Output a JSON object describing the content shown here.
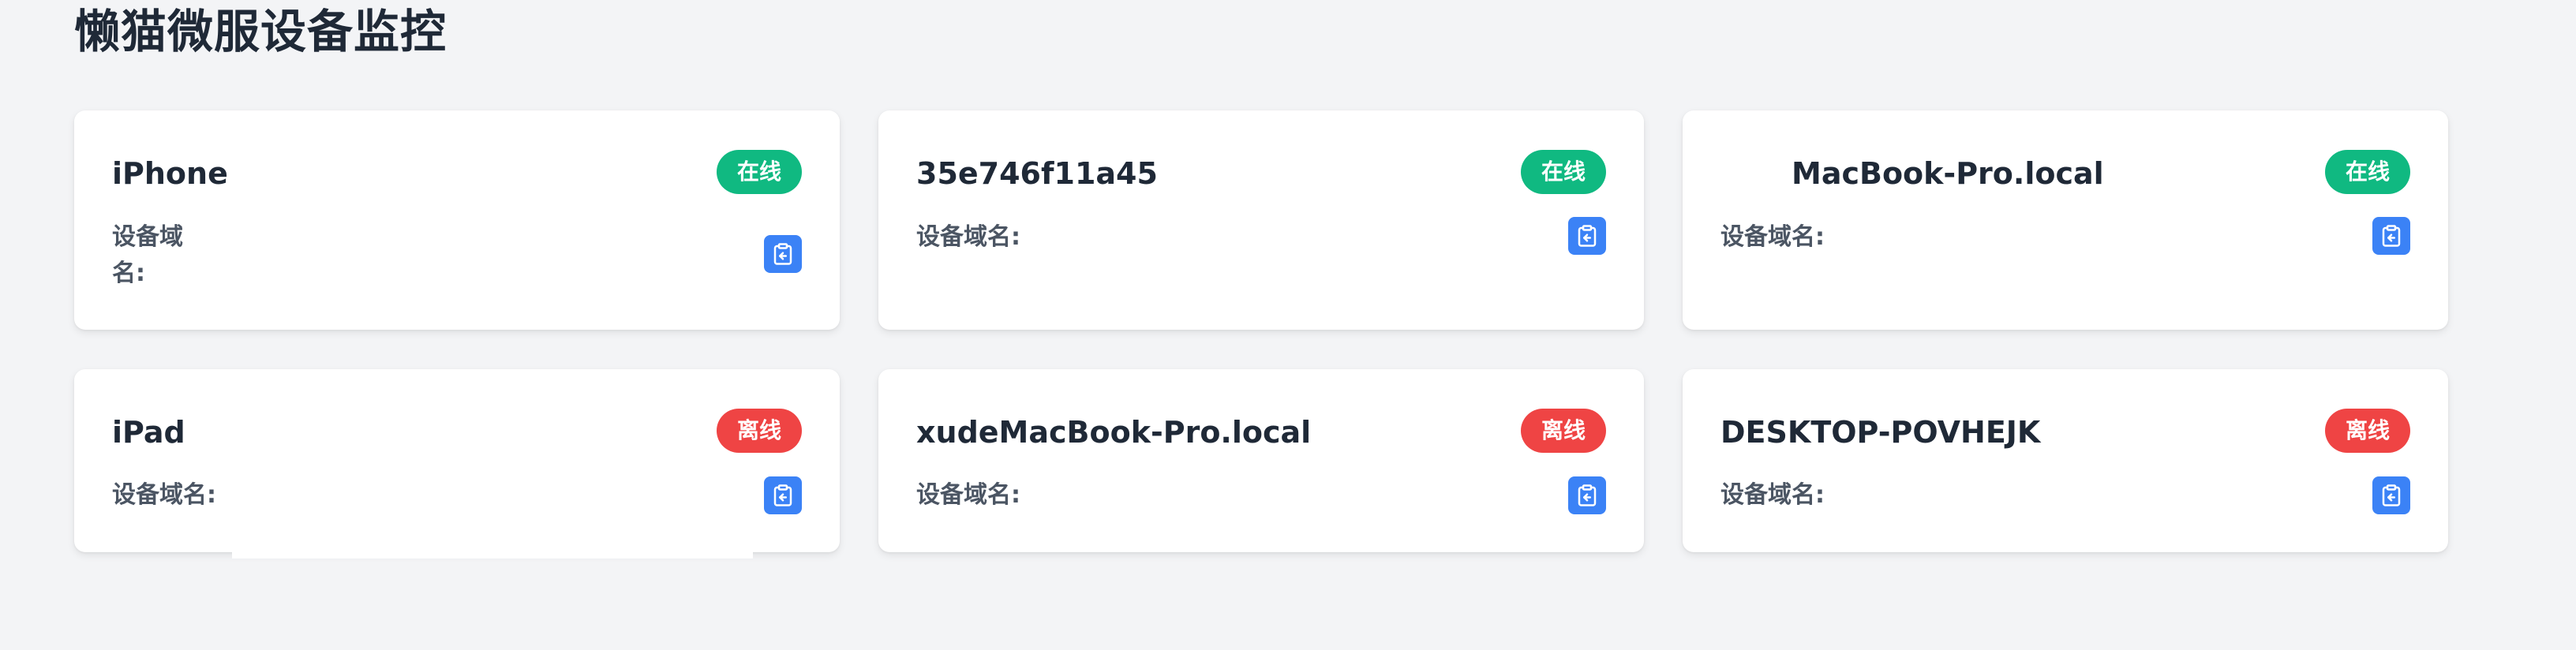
{
  "page": {
    "title": "懒猫微服设备监控"
  },
  "devices": [
    {
      "name": "iPhone",
      "status": "在线",
      "domain_label": "设备域名:"
    },
    {
      "name": "35e746f11a45",
      "status": "在线",
      "domain_label": "设备域名:"
    },
    {
      "name": "MacBook-Pro.local",
      "status": "在线",
      "domain_label": "设备域名:"
    },
    {
      "name": "iPad",
      "status": "离线",
      "domain_label": "设备域名:"
    },
    {
      "name": "xudeMacBook-Pro.local",
      "status": "离线",
      "domain_label": "设备域名:"
    },
    {
      "name": "DESKTOP-POVHEJK",
      "status": "离线",
      "domain_label": "设备域名:"
    }
  ],
  "icons": {
    "copy": "clipboard-copy-icon"
  },
  "colors": {
    "background": "#f3f4f6",
    "online": "#10b981",
    "offline": "#ef4444",
    "copy_button": "#3b82f6"
  }
}
